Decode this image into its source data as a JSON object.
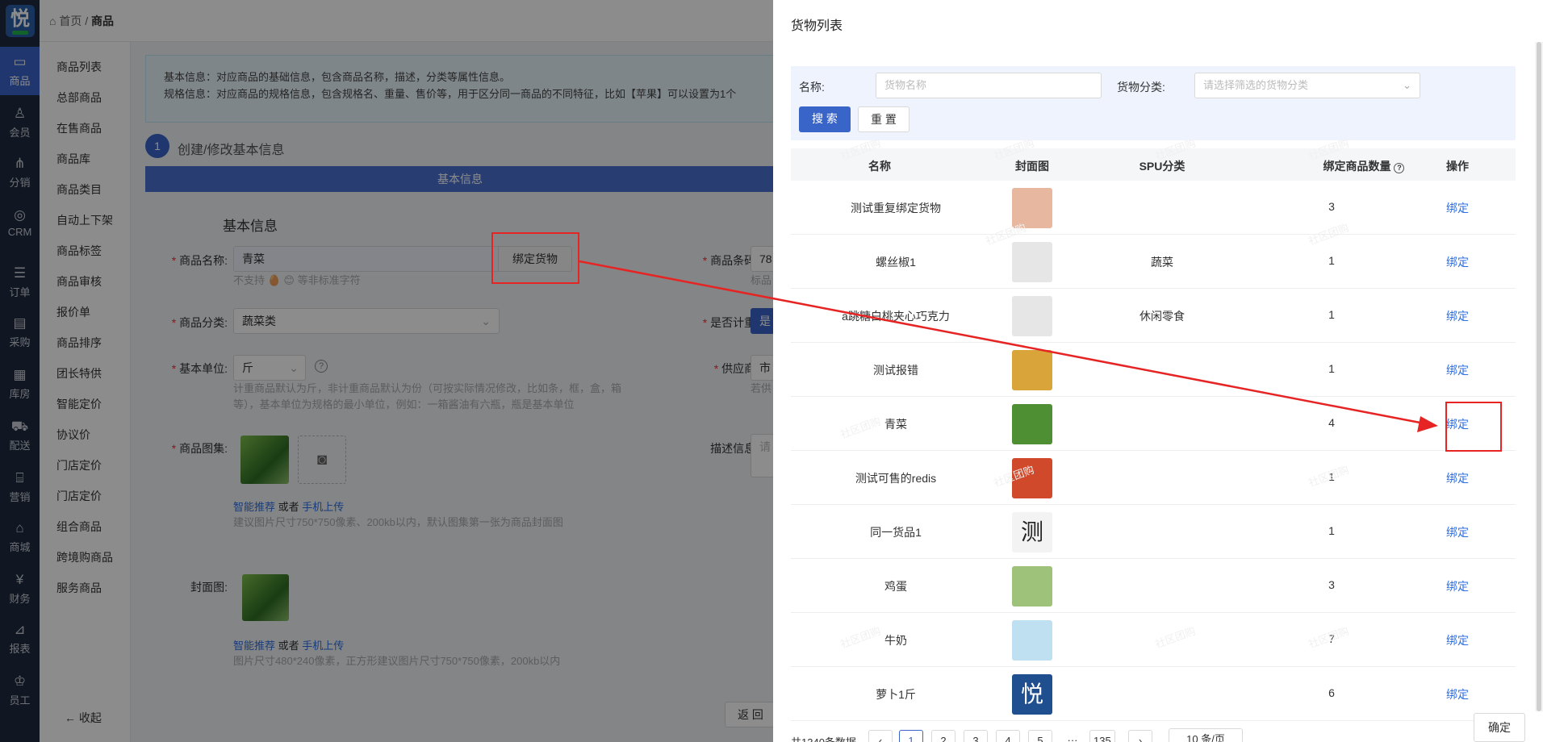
{
  "rail": {
    "logo": "悦",
    "items": [
      {
        "label": "商品",
        "icon": "box-icon",
        "glyph": "▭"
      },
      {
        "label": "会员",
        "icon": "user-icon",
        "glyph": "♙"
      },
      {
        "label": "分销",
        "icon": "share-icon",
        "glyph": "⋔"
      },
      {
        "label": "CRM",
        "icon": "crm-icon",
        "glyph": "◎"
      },
      {
        "label": "订单",
        "icon": "order-icon",
        "glyph": "☰"
      },
      {
        "label": "采购",
        "icon": "purchase-icon",
        "glyph": "▤"
      },
      {
        "label": "库房",
        "icon": "warehouse-icon",
        "glyph": "▦"
      },
      {
        "label": "配送",
        "icon": "truck-icon",
        "glyph": "⛟"
      },
      {
        "label": "营销",
        "icon": "gift-icon",
        "glyph": "⌸"
      },
      {
        "label": "商城",
        "icon": "home-icon",
        "glyph": "⌂"
      },
      {
        "label": "财务",
        "icon": "yen-icon",
        "glyph": "¥"
      },
      {
        "label": "报表",
        "icon": "chart-icon",
        "glyph": "⊿"
      },
      {
        "label": "员工",
        "icon": "staff-icon",
        "glyph": "♔"
      }
    ]
  },
  "breadcrumb": {
    "home": "首页",
    "current": "商品"
  },
  "submenu": [
    "商品列表",
    "总部商品",
    "在售商品",
    "商品库",
    "商品类目",
    "自动上下架",
    "商品标签",
    "商品审核",
    "报价单",
    "商品排序",
    "团长特供",
    "智能定价",
    "协议价",
    "门店定价",
    "门店定价",
    "组合商品",
    "跨境购商品",
    "服务商品"
  ],
  "collapse_label": "收起",
  "form": {
    "tip_line1": "基本信息：对应商品的基础信息，包含商品名称，描述，分类等属性信息。",
    "tip_line2": "规格信息：对应商品的规格信息，包含规格名、重量、售价等，用于区分同一商品的不同特征，比如【苹果】可以设置为1个",
    "step_num": "1",
    "step_label": "创建/修改基本信息",
    "tab_label": "基本信息",
    "section_title": "基本信息",
    "name_label": "商品名称:",
    "name_value": "青菜",
    "bind_goods_btn": "绑定货物",
    "name_hint": "不支持 🥚 😊 等非标准字符",
    "barcode_label": "商品条码:",
    "barcode_value": "78",
    "barcode_hint": "标品",
    "category_label": "商品分类:",
    "category_value": "蔬菜类",
    "weigh_label": "是否计重:",
    "weigh_value": "是",
    "unit_label": "基本单位:",
    "unit_value": "斤",
    "supplier_label": "供应商:",
    "supplier_value": "市",
    "supplier_hint": "若供",
    "unit_hint1": "计重商品默认为斤，非计重商品默认为份（可按实际情况修改，比如条，框，盒，箱",
    "unit_hint2": "等），基本单位为规格的最小单位，例如：一箱酱油有六瓶，瓶是基本单位",
    "gallery_label": "商品图集:",
    "desc_label": "描述信息:",
    "desc_placeholder": "请",
    "smart_recommend": "智能推荐",
    "or": "或者",
    "mobile_upload": "手机上传",
    "gallery_hint": "建议图片尺寸750*750像素、200kb以内，默认图集第一张为商品封面图",
    "cover_label": "封面图:",
    "cover_hint": "图片尺寸480*240像素，正方形建议图片尺寸750*750像素，200kb以内",
    "back_btn": "返 回"
  },
  "drawer": {
    "title": "货物列表",
    "filter": {
      "name_label": "名称:",
      "name_placeholder": "货物名称",
      "cat_label": "货物分类:",
      "cat_placeholder": "请选择筛选的货物分类",
      "search_btn": "搜 索",
      "reset_btn": "重 置"
    },
    "columns": [
      "名称",
      "封面图",
      "SPU分类",
      "绑定商品数量",
      "操作"
    ],
    "rows": [
      {
        "name": "测试重复绑定货物",
        "spu": "",
        "count": "3",
        "action": "绑定",
        "img": "#e8b7a0"
      },
      {
        "name": "螺丝椒1",
        "spu": "蔬菜",
        "count": "1",
        "action": "绑定",
        "img": "#e6e6e6"
      },
      {
        "name": "a跳糖白桃夹心巧克力",
        "spu": "休闲零食",
        "count": "1",
        "action": "绑定",
        "img": "#e6e6e6"
      },
      {
        "name": "测试报错",
        "spu": "",
        "count": "1",
        "action": "绑定",
        "img": "#d9a43a"
      },
      {
        "name": "青菜",
        "spu": "",
        "count": "4",
        "action": "绑定",
        "img": "#4f8f33"
      },
      {
        "name": "测试可售的redis",
        "spu": "",
        "count": "1",
        "action": "绑定",
        "img": "#d0492b"
      },
      {
        "name": "同一货品1",
        "spu": "",
        "count": "1",
        "action": "绑定",
        "img": "#f3f3f3",
        "glyph": "测"
      },
      {
        "name": "鸡蛋",
        "spu": "",
        "count": "3",
        "action": "绑定",
        "img": "#9fc27a"
      },
      {
        "name": "牛奶",
        "spu": "",
        "count": "7",
        "action": "绑定",
        "img": "#bfe0f0"
      },
      {
        "name": "萝卜1斤",
        "spu": "",
        "count": "6",
        "action": "绑定",
        "img": "#1f4f8f",
        "glyph": "悦"
      }
    ],
    "total": "共1340条数据",
    "pages": [
      "‹",
      "1",
      "2",
      "3",
      "4",
      "5",
      "···",
      "135",
      "›"
    ],
    "page_size": "10 条/页",
    "confirm_btn": "确定",
    "watermark": "社区团购"
  }
}
